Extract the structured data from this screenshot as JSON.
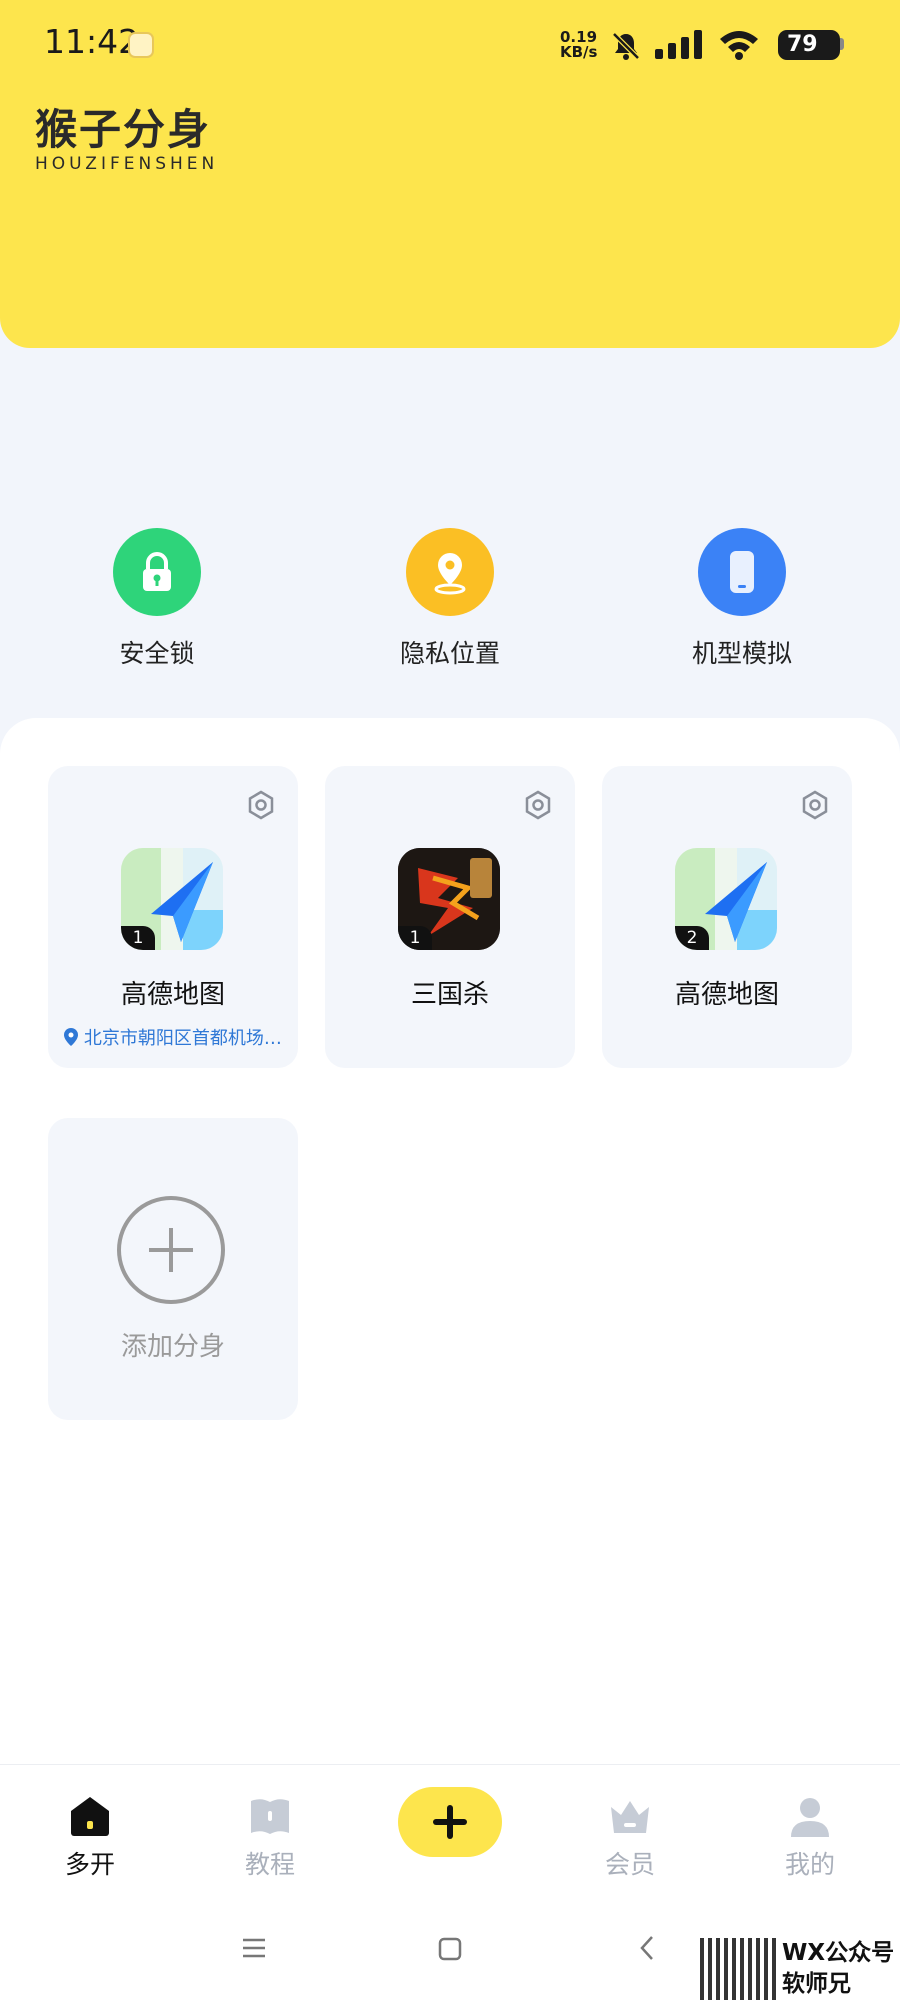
{
  "status_bar": {
    "time": "11:42",
    "net_speed_value": "0.19",
    "net_speed_unit": "KB/s",
    "battery": "79"
  },
  "brand": {
    "name_cn": "猴子分身",
    "name_en": "HOUZIFENSHEN"
  },
  "quick_actions": [
    {
      "label": "安全锁",
      "icon": "lock-icon",
      "color": "#2ed47a"
    },
    {
      "label": "隐私位置",
      "icon": "location-pin-icon",
      "color": "#fbbf24"
    },
    {
      "label": "机型模拟",
      "icon": "phone-icon",
      "color": "#3b82f6"
    }
  ],
  "apps": [
    {
      "name": "高德地图",
      "badge": "1",
      "sub": "北京市朝阳区首都机场…",
      "icon": "amap-icon"
    },
    {
      "name": "三国杀",
      "badge": "1",
      "sub": "",
      "icon": "sanguosha-icon"
    },
    {
      "name": "高德地图",
      "badge": "2",
      "sub": "",
      "icon": "amap-icon"
    }
  ],
  "add_card": {
    "label": "添加分身"
  },
  "bottom_nav": [
    {
      "label": "多开",
      "icon": "home-icon",
      "active": true
    },
    {
      "label": "教程",
      "icon": "book-icon",
      "active": false
    },
    {
      "label": "",
      "icon": "plus-icon",
      "active": false
    },
    {
      "label": "会员",
      "icon": "crown-icon",
      "active": false
    },
    {
      "label": "我的",
      "icon": "user-icon",
      "active": false
    }
  ],
  "watermark": {
    "line1": "WX公众号",
    "line2": "软师兄"
  },
  "colors": {
    "brand_yellow": "#fde54d",
    "link_blue": "#2f78d6",
    "page_bg": "#f2f5fb"
  }
}
